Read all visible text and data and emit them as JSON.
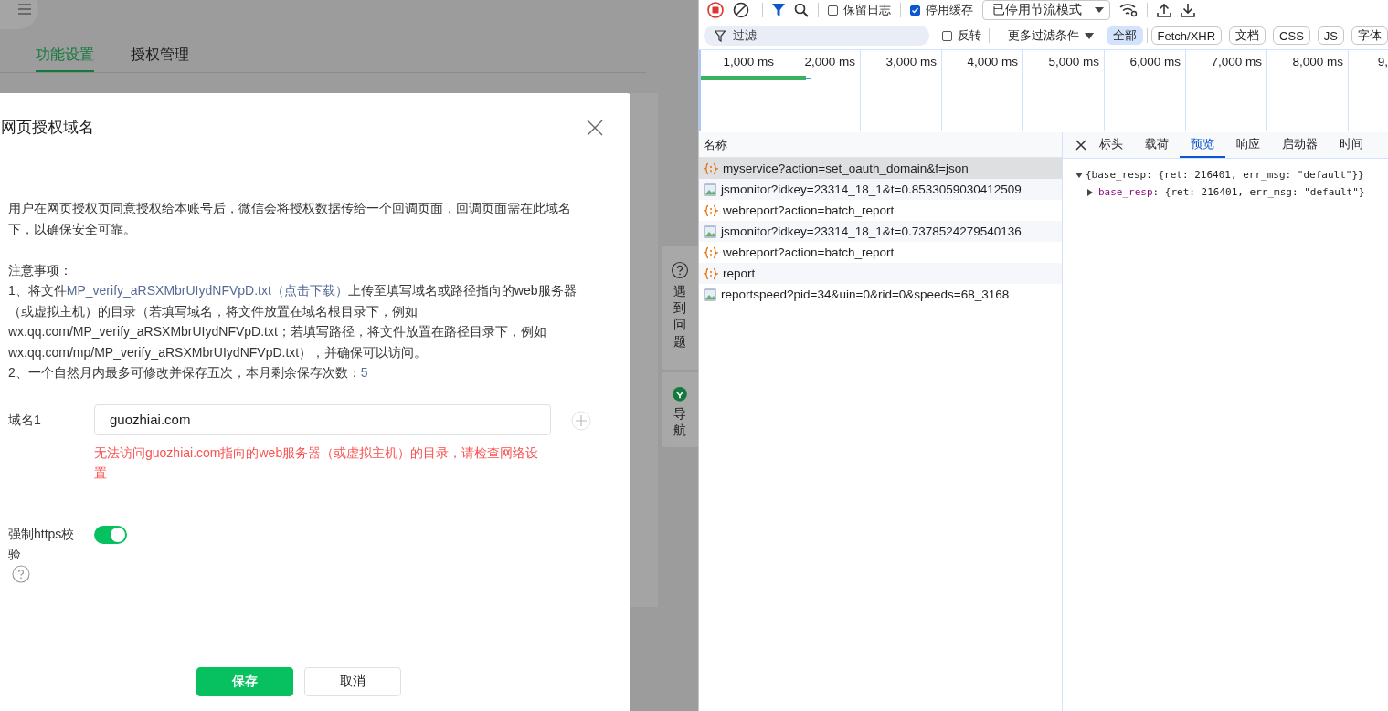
{
  "page": {
    "tabs": [
      {
        "label": "功能设置",
        "selected": true
      },
      {
        "label": "授权管理",
        "selected": false
      }
    ],
    "side_buttons": [
      {
        "label": "遇到问题",
        "kind": "help"
      },
      {
        "label": "导航",
        "kind": "nav"
      }
    ]
  },
  "dialog": {
    "title": "网页授权域名",
    "description": "用户在网页授权页同意授权给本账号后，微信会将授权数据传给一个回调页面，回调页面需在此域名下，以确保安全可靠。",
    "notes_title": "注意事项：",
    "note_1": {
      "before": "1、将文件",
      "link": "MP_verify_aRSXMbrUIydNFVpD.txt（点击下载）",
      "after": "上传至填写域名或路径指向的web服务器（或虚拟主机）的目录（若填写域名，将文件放置在域名根目录下，例如wx.qq.com/MP_verify_aRSXMbrUIydNFVpD.txt；若填写路径，将文件放置在路径目录下，例如wx.qq.com/mp/MP_verify_aRSXMbrUIydNFVpD.txt），并确保可以访问。"
    },
    "note_2": {
      "text": "2、一个自然月内最多可修改并保存五次，本月剩余保存次数：",
      "count": "5"
    },
    "domain": {
      "label": "域名1",
      "value": "guozhiai.com",
      "error": "无法访问guozhiai.com指向的web服务器（或虚拟主机）的目录，请检查网络设置"
    },
    "https_toggle": {
      "label": "强制https校验",
      "on": true
    },
    "buttons": [
      {
        "label": "保存",
        "kind": "primary"
      },
      {
        "label": "取消",
        "kind": "default"
      }
    ]
  },
  "devtools": {
    "recording": true,
    "preserve_log": {
      "label": "保留日志",
      "checked": false
    },
    "disable_cache": {
      "label": "停用缓存",
      "checked": true
    },
    "throttling": "已停用节流模式",
    "filter": {
      "placeholder": "过滤"
    },
    "invert": {
      "label": "反转",
      "checked": false
    },
    "more_filters": "更多过滤条件",
    "type_filters": [
      {
        "label": "全部",
        "selected": true
      },
      {
        "label": "Fetch/XHR",
        "selected": false
      },
      {
        "label": "文档",
        "selected": false
      },
      {
        "label": "CSS",
        "selected": false
      },
      {
        "label": "JS",
        "selected": false
      },
      {
        "label": "字体",
        "selected": false
      }
    ],
    "timeline_ticks": [
      "1,000 ms",
      "2,000 ms",
      "3,000 ms",
      "4,000 ms",
      "5,000 ms",
      "6,000 ms",
      "7,000 ms",
      "8,000 ms",
      "9,"
    ],
    "name_column": "名称",
    "requests": [
      {
        "name": "myservice?action=set_oauth_domain&f=json",
        "kind": "xhr",
        "selected": true
      },
      {
        "name": "jsmonitor?idkey=23314_18_1&t=0.8533059030412509",
        "kind": "image",
        "selected": false
      },
      {
        "name": "webreport?action=batch_report",
        "kind": "xhr",
        "selected": false
      },
      {
        "name": "jsmonitor?idkey=23314_18_1&t=0.7378524279540136",
        "kind": "image",
        "selected": false
      },
      {
        "name": "webreport?action=batch_report",
        "kind": "xhr",
        "selected": false
      },
      {
        "name": "report",
        "kind": "xhr",
        "selected": false
      },
      {
        "name": "reportspeed?pid=34&uin=0&rid=0&speeds=68_3168",
        "kind": "image",
        "selected": false
      }
    ],
    "detail_tabs": [
      {
        "label": "标头",
        "selected": false
      },
      {
        "label": "载荷",
        "selected": false
      },
      {
        "label": "预览",
        "selected": true
      },
      {
        "label": "响应",
        "selected": false
      },
      {
        "label": "启动器",
        "selected": false
      },
      {
        "label": "时间",
        "selected": false
      }
    ],
    "preview": {
      "summary": "{base_resp: {ret: 216401, err_msg: \"default\"}}",
      "expanded": true,
      "children": [
        {
          "key": "base_resp",
          "value": ": {ret: 216401, err_msg: \"default\"}",
          "expanded": false
        }
      ]
    }
  }
}
